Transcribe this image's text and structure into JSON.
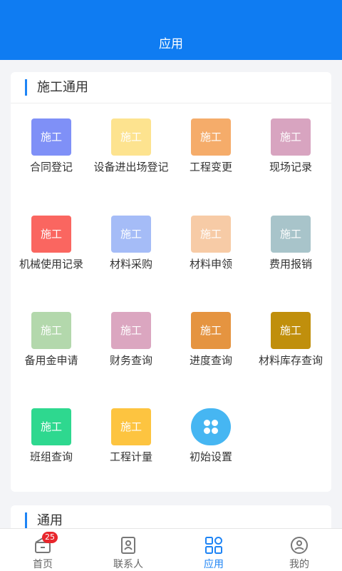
{
  "header": {
    "title": "应用"
  },
  "sections": [
    {
      "title": "施工通用",
      "items": [
        {
          "label": "合同登记",
          "icon_text": "施工",
          "color": "#7f90f7"
        },
        {
          "label": "设备进出场登记",
          "icon_text": "施工",
          "color": "#fde38f"
        },
        {
          "label": "工程变更",
          "icon_text": "施工",
          "color": "#f5ac6a"
        },
        {
          "label": "现场记录",
          "icon_text": "施工",
          "color": "#d8a4c0"
        },
        {
          "label": "机械使用记录",
          "icon_text": "施工",
          "color": "#fa6660"
        },
        {
          "label": "材料采购",
          "icon_text": "施工",
          "color": "#a5bcf7"
        },
        {
          "label": "材料申领",
          "icon_text": "施工",
          "color": "#f7cba6"
        },
        {
          "label": "费用报销",
          "icon_text": "施工",
          "color": "#a8c4ca"
        },
        {
          "label": "备用金申请",
          "icon_text": "施工",
          "color": "#b3d8ac"
        },
        {
          "label": "财务查询",
          "icon_text": "施工",
          "color": "#dba6c0"
        },
        {
          "label": "进度查询",
          "icon_text": "施工",
          "color": "#e59440"
        },
        {
          "label": "材料库存查询",
          "icon_text": "施工",
          "color": "#c08f0c"
        },
        {
          "label": "班组查询",
          "icon_text": "施工",
          "color": "#2ed88f"
        },
        {
          "label": "工程计量",
          "icon_text": "施工",
          "color": "#fdc440"
        },
        {
          "label": "初始设置",
          "icon_text": "",
          "color": "#46b6f2",
          "icon": "settings-dots-icon"
        }
      ]
    },
    {
      "title": "通用"
    }
  ],
  "tabbar": {
    "badge": "25",
    "tabs": [
      {
        "label": "首页",
        "icon": "home-icon"
      },
      {
        "label": "联系人",
        "icon": "contacts-icon"
      },
      {
        "label": "应用",
        "icon": "apps-grid-icon",
        "active": true
      },
      {
        "label": "我的",
        "icon": "profile-icon"
      }
    ],
    "active_color": "#1e84f5"
  }
}
